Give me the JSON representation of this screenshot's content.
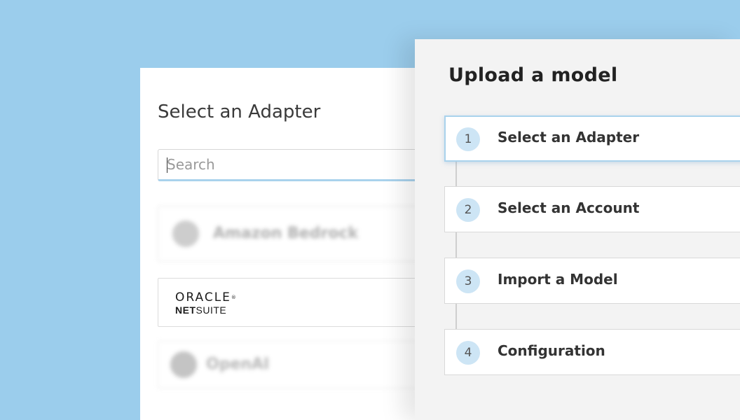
{
  "adapter_panel": {
    "title": "Select an Adapter",
    "search": {
      "placeholder": "Search",
      "value": ""
    },
    "adapters": [
      {
        "label": "Amazon Bedrock",
        "icon": "bedrock-icon",
        "state": "blurred"
      },
      {
        "label": "ORACLE NETSUITE",
        "logo_top": "ORACLE",
        "logo_bottom_bold": "NET",
        "logo_bottom": "SUITE",
        "icon": "oracle-netsuite-logo",
        "state": "visible"
      },
      {
        "label": "OpenAI",
        "icon": "openai-icon",
        "state": "blurred"
      }
    ]
  },
  "upload_panel": {
    "title": "Upload a model",
    "steps": [
      {
        "number": "1",
        "label": "Select an Adapter",
        "active": true
      },
      {
        "number": "2",
        "label": "Select an Account",
        "active": false
      },
      {
        "number": "3",
        "label": "Import a Model",
        "active": false
      },
      {
        "number": "4",
        "label": "Configuration",
        "active": false
      }
    ]
  },
  "colors": {
    "background": "#9bcdec",
    "accent": "#a9d2ec",
    "step_badge": "#cde5f5"
  }
}
